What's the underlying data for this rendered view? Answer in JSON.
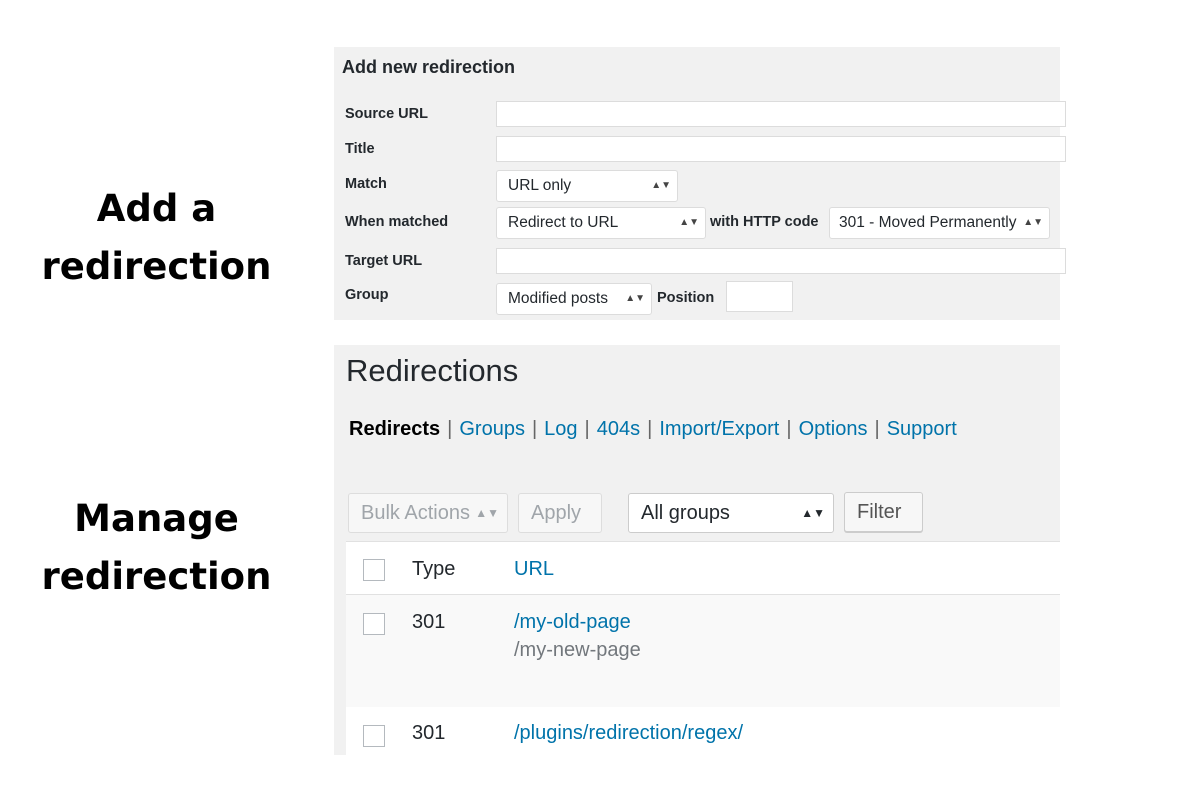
{
  "labels": {
    "add_line1": "Add a",
    "add_line2": "redirection",
    "manage_line1": "Manage",
    "manage_line2": "redirection"
  },
  "add_form": {
    "title": "Add new redirection",
    "source_url_label": "Source URL",
    "source_url_value": "",
    "title_label": "Title",
    "title_value": "",
    "match_label": "Match",
    "match_value": "URL only",
    "when_matched_label": "When matched",
    "when_matched_value": "Redirect to URL",
    "http_code_label": "with HTTP code",
    "http_code_value": "301 - Moved Permanently",
    "target_url_label": "Target URL",
    "target_url_value": "",
    "group_label": "Group",
    "group_value": "Modified posts",
    "position_label": "Position",
    "position_value": ""
  },
  "manage": {
    "heading": "Redirections",
    "nav": {
      "current": "Redirects",
      "links": [
        "Groups",
        "Log",
        "404s",
        "Import/Export",
        "Options",
        "Support"
      ]
    },
    "bulk_actions": "Bulk Actions",
    "apply": "Apply",
    "group_filter": "All groups",
    "filter": "Filter",
    "columns": {
      "type": "Type",
      "url": "URL"
    },
    "rows": [
      {
        "type": "301",
        "url": "/my-old-page",
        "target": "/my-new-page"
      },
      {
        "type": "301",
        "url": "/plugins/redirection/regex/",
        "target": ""
      }
    ]
  },
  "icons": {
    "select_arrow": "select-arrows-icon"
  }
}
